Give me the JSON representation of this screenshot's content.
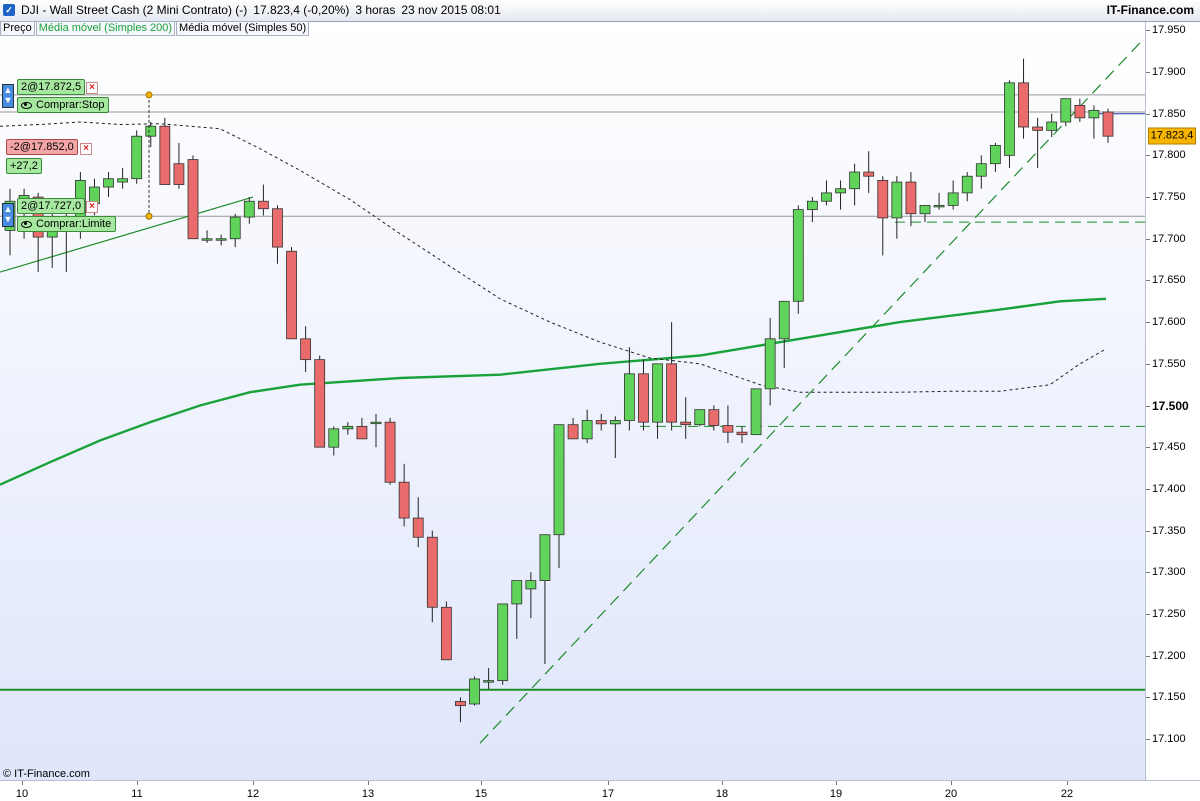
{
  "titlebar": {
    "icon": "chart-window-icon",
    "symbol": "DJI - Wall Street Cash (2 Mini Contrato) (-)",
    "quote": "17.823,4 (-0,20%)",
    "timeframe": "3 horas",
    "datetime": "23 nov 2015 08:01",
    "brand": "IT-Finance.com"
  },
  "legend": [
    {
      "label": "Preço"
    },
    {
      "label": "Média móvel (Simples 200)",
      "color": "#19a23a"
    },
    {
      "label": "Média móvel (Simples 50)"
    }
  ],
  "copyright": "© IT-Finance.com",
  "price_tag": "17.823,4",
  "y_axis": [
    "17.950",
    "17.900",
    "17.850",
    "17.800",
    "17.750",
    "17.700",
    "17.650",
    "17.600",
    "17.550",
    "17.500",
    "17.450",
    "17.400",
    "17.350",
    "17.300",
    "17.250",
    "17.200",
    "17.150",
    "17.100"
  ],
  "y_axis_main": "17.500",
  "x_axis": [
    "10",
    "11",
    "12",
    "13",
    "15",
    "17",
    "18",
    "19",
    "20",
    "22"
  ],
  "orders": {
    "stop": {
      "label": "2@17.872,5",
      "type": "Comprar:Stop"
    },
    "position": {
      "label": "-2@17.852,0",
      "pnl": "+27,2"
    },
    "limit": {
      "label": "2@17.727,0",
      "type": "Comprar:Limite"
    }
  },
  "colors": {
    "up": "#5fd35a",
    "down": "#e96b6b",
    "sma200": "#19a23a",
    "sma50": "#222222",
    "support": "#1f8a2a",
    "price_line": "#1e3fb5",
    "tag": "#f7b500"
  },
  "chart_data": {
    "type": "candlestick",
    "instrument": "DJI - Wall Street Cash (2 Mini Contrato)",
    "timeframe": "3 horas",
    "y_range": [
      17055,
      17980
    ],
    "x_labels": [
      "10",
      "11",
      "12",
      "13",
      "15",
      "17",
      "18",
      "19",
      "20",
      "22"
    ],
    "candles": [
      [
        17710,
        17760,
        17680,
        17745
      ],
      [
        17745,
        17760,
        17700,
        17752
      ],
      [
        17750,
        17755,
        17660,
        17702
      ],
      [
        17702,
        17740,
        17665,
        17722
      ],
      [
        17718,
        17740,
        17660,
        17712
      ],
      [
        17712,
        17780,
        17700,
        17770
      ],
      [
        17742,
        17772,
        17728,
        17762
      ],
      [
        17762,
        17780,
        17750,
        17772
      ],
      [
        17768,
        17785,
        17760,
        17772
      ],
      [
        17772,
        17830,
        17766,
        17823
      ],
      [
        17823,
        17840,
        17810,
        17835
      ],
      [
        17835,
        17845,
        17765,
        17765
      ],
      [
        17790,
        17815,
        17760,
        17765
      ],
      [
        17795,
        17800,
        17700,
        17700
      ],
      [
        17700,
        17710,
        17695,
        17700
      ],
      [
        17700,
        17705,
        17692,
        17700
      ],
      [
        17700,
        17730,
        17690,
        17726
      ],
      [
        17726,
        17750,
        17718,
        17745
      ],
      [
        17745,
        17765,
        17728,
        17736
      ],
      [
        17736,
        17740,
        17670,
        17690
      ],
      [
        17685,
        17690,
        17590,
        17580
      ],
      [
        17580,
        17595,
        17540,
        17555
      ],
      [
        17555,
        17560,
        17450,
        17450
      ],
      [
        17450,
        17475,
        17440,
        17472
      ],
      [
        17472,
        17480,
        17465,
        17475
      ],
      [
        17475,
        17485,
        17460,
        17460
      ],
      [
        17480,
        17490,
        17450,
        17480
      ],
      [
        17480,
        17485,
        17405,
        17408
      ],
      [
        17408,
        17430,
        17355,
        17365
      ],
      [
        17365,
        17390,
        17330,
        17342
      ],
      [
        17342,
        17350,
        17240,
        17258
      ],
      [
        17258,
        17265,
        17195,
        17195
      ],
      [
        17145,
        17150,
        17120,
        17140
      ],
      [
        17142,
        17175,
        17140,
        17172
      ],
      [
        17170,
        17185,
        17160,
        17170
      ],
      [
        17170,
        17200,
        17165,
        17262
      ],
      [
        17262,
        17285,
        17220,
        17290
      ],
      [
        17280,
        17300,
        17245,
        17290
      ],
      [
        17290,
        17335,
        17190,
        17345
      ],
      [
        17345,
        17360,
        17305,
        17477
      ],
      [
        17477,
        17485,
        17462,
        17460
      ],
      [
        17460,
        17495,
        17455,
        17482
      ],
      [
        17482,
        17490,
        17470,
        17478
      ],
      [
        17478,
        17487,
        17437,
        17482
      ],
      [
        17482,
        17570,
        17470,
        17538
      ],
      [
        17538,
        17555,
        17470,
        17480
      ],
      [
        17480,
        17550,
        17460,
        17550
      ],
      [
        17550,
        17600,
        17470,
        17480
      ],
      [
        17480,
        17510,
        17460,
        17477
      ],
      [
        17477,
        17495,
        17475,
        17495
      ],
      [
        17495,
        17500,
        17470,
        17476
      ],
      [
        17476,
        17500,
        17455,
        17468
      ],
      [
        17468,
        17475,
        17455,
        17465
      ],
      [
        17465,
        17520,
        17470,
        17520
      ],
      [
        17520,
        17605,
        17500,
        17580
      ],
      [
        17580,
        17625,
        17545,
        17625
      ],
      [
        17625,
        17740,
        17610,
        17735
      ],
      [
        17735,
        17750,
        17720,
        17745
      ],
      [
        17745,
        17770,
        17740,
        17755
      ],
      [
        17755,
        17770,
        17735,
        17760
      ],
      [
        17760,
        17790,
        17740,
        17780
      ],
      [
        17780,
        17805,
        17755,
        17775
      ],
      [
        17770,
        17775,
        17680,
        17725
      ],
      [
        17725,
        17775,
        17700,
        17768
      ],
      [
        17768,
        17780,
        17715,
        17730
      ],
      [
        17730,
        17740,
        17720,
        17740
      ],
      [
        17740,
        17755,
        17735,
        17740
      ],
      [
        17740,
        17770,
        17735,
        17755
      ],
      [
        17755,
        17780,
        17745,
        17775
      ],
      [
        17775,
        17800,
        17760,
        17790
      ],
      [
        17790,
        17815,
        17780,
        17812
      ],
      [
        17800,
        17890,
        17785,
        17887
      ],
      [
        17887,
        17916,
        17820,
        17834
      ],
      [
        17834,
        17845,
        17785,
        17830
      ],
      [
        17830,
        17850,
        17822,
        17840
      ],
      [
        17840,
        17865,
        17835,
        17868
      ],
      [
        17860,
        17868,
        17840,
        17845
      ],
      [
        17845,
        17860,
        17820,
        17854
      ],
      [
        17852,
        17856,
        17815,
        17823
      ]
    ],
    "sma200": [
      [
        0,
        17405
      ],
      [
        50,
        17432
      ],
      [
        100,
        17458
      ],
      [
        150,
        17480
      ],
      [
        200,
        17500
      ],
      [
        250,
        17516
      ],
      [
        300,
        17525
      ],
      [
        400,
        17533
      ],
      [
        500,
        17537
      ],
      [
        600,
        17550
      ],
      [
        700,
        17560
      ],
      [
        800,
        17580
      ],
      [
        900,
        17600
      ],
      [
        1000,
        17615
      ],
      [
        1060,
        17625
      ],
      [
        1106,
        17628
      ]
    ],
    "sma50": [
      [
        0,
        17835
      ],
      [
        40,
        17837
      ],
      [
        80,
        17840
      ],
      [
        120,
        17837
      ],
      [
        160,
        17838
      ],
      [
        220,
        17832
      ],
      [
        260,
        17808
      ],
      [
        300,
        17782
      ],
      [
        350,
        17747
      ],
      [
        400,
        17706
      ],
      [
        450,
        17667
      ],
      [
        500,
        17628
      ],
      [
        550,
        17600
      ],
      [
        600,
        17576
      ],
      [
        650,
        17557
      ],
      [
        700,
        17550
      ],
      [
        760,
        17525
      ],
      [
        800,
        17516
      ],
      [
        850,
        17516
      ],
      [
        900,
        17516
      ],
      [
        950,
        17517
      ],
      [
        1000,
        17517
      ],
      [
        1050,
        17525
      ],
      [
        1080,
        17550
      ],
      [
        1106,
        17568
      ]
    ],
    "horizontal_lines": [
      {
        "price": 17872.5,
        "style": "solid",
        "color": "#999999",
        "label": "stop"
      },
      {
        "price": 17852.0,
        "style": "solid",
        "color": "#999999",
        "label": "position"
      },
      {
        "price": 17850.0,
        "style": "solid",
        "color": "#1e3fb5",
        "label": "current"
      },
      {
        "price": 17727.0,
        "style": "solid",
        "color": "#999999",
        "label": "limit"
      },
      {
        "price": 17720.0,
        "style": "dashed",
        "color": "#1f8a2a"
      },
      {
        "price": 17475.0,
        "style": "dashed",
        "color": "#1f8a2a"
      },
      {
        "price": 17159.0,
        "style": "solid",
        "color": "#1f8a2a",
        "width": 2
      }
    ],
    "trend_lines": [
      {
        "from": [
          0,
          17660
        ],
        "to": [
          253,
          17750
        ],
        "style": "solid",
        "color": "#1f8a2a"
      },
      {
        "from": [
          480,
          17095
        ],
        "to": [
          1140,
          17935
        ],
        "style": "dashed",
        "color": "#1f8a2a"
      }
    ]
  }
}
